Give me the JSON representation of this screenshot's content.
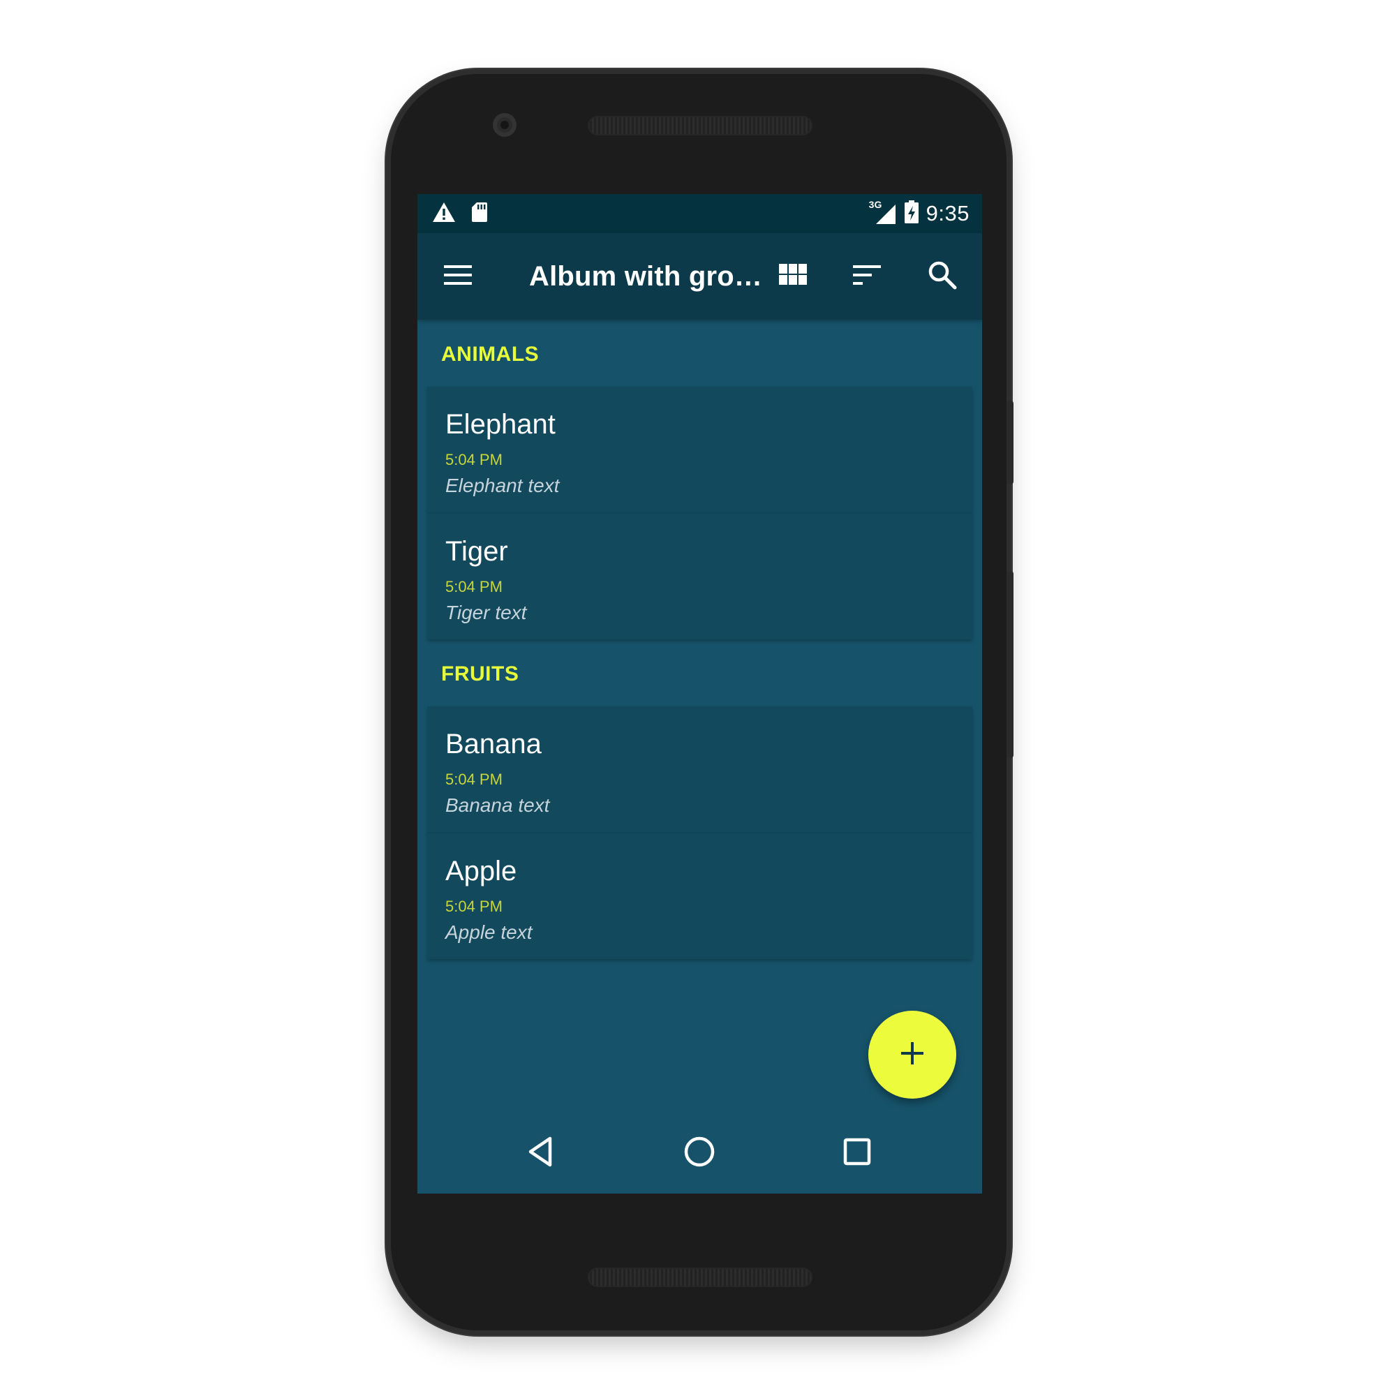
{
  "status_bar": {
    "time": "9:35",
    "network": "3G",
    "icons": [
      "warning-icon",
      "sd-card-icon",
      "signal-icon",
      "battery-charging-icon"
    ]
  },
  "app_bar": {
    "title": "Album with gro…",
    "actions": [
      "menu-icon",
      "grid-view-icon",
      "sort-icon",
      "search-icon"
    ]
  },
  "sections": [
    {
      "header": "ANIMALS",
      "items": [
        {
          "title": "Elephant",
          "time": "5:04 PM",
          "text": "Elephant text"
        },
        {
          "title": "Tiger",
          "time": "5:04 PM",
          "text": "Tiger text"
        }
      ]
    },
    {
      "header": "FRUITS",
      "items": [
        {
          "title": "Banana",
          "time": "5:04 PM",
          "text": "Banana text"
        },
        {
          "title": "Apple",
          "time": "5:04 PM",
          "text": "Apple text"
        }
      ]
    }
  ],
  "fab": {
    "icon": "add-icon"
  },
  "nav_bar": {
    "buttons": [
      "back-icon",
      "home-icon",
      "recents-icon"
    ]
  },
  "colors": {
    "accent": "#edfb3d",
    "background": "#16536a",
    "card": "#13495d",
    "app_bar": "#0c3a4a",
    "status_bar": "#05323f"
  }
}
